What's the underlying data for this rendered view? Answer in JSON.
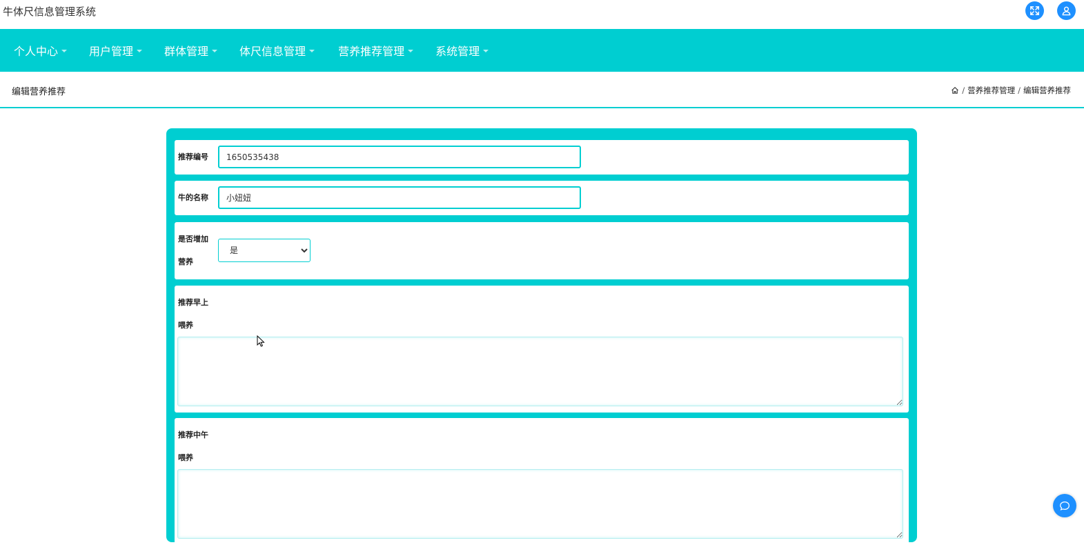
{
  "app": {
    "title": "牛体尺信息管理系统"
  },
  "header_icons": {
    "fullscreen": "fullscreen-icon",
    "user": "user-icon"
  },
  "nav": {
    "items": [
      {
        "label": "个人中心"
      },
      {
        "label": "用户管理"
      },
      {
        "label": "群体管理"
      },
      {
        "label": "体尺信息管理"
      },
      {
        "label": "营养推荐管理"
      },
      {
        "label": "系统管理"
      }
    ]
  },
  "page": {
    "title": "编辑营养推荐",
    "breadcrumb": [
      "营养推荐管理",
      "编辑营养推荐"
    ],
    "separator": "/"
  },
  "form": {
    "recommend_no": {
      "label": "推荐编号",
      "value": "1650535438"
    },
    "cow_name": {
      "label": "牛的名称",
      "value": "小妞妞"
    },
    "add_nutrition": {
      "label_line1": "是否增加",
      "label_line2": "营养",
      "selected": "是"
    },
    "morning_feed": {
      "label_line1": "推荐早上",
      "label_line2": "喂养",
      "value": ""
    },
    "noon_feed": {
      "label_line1": "推荐中午",
      "label_line2": "喂养",
      "value": ""
    }
  },
  "colors": {
    "accent": "#00ced1",
    "button_blue": "#1e90ff"
  }
}
